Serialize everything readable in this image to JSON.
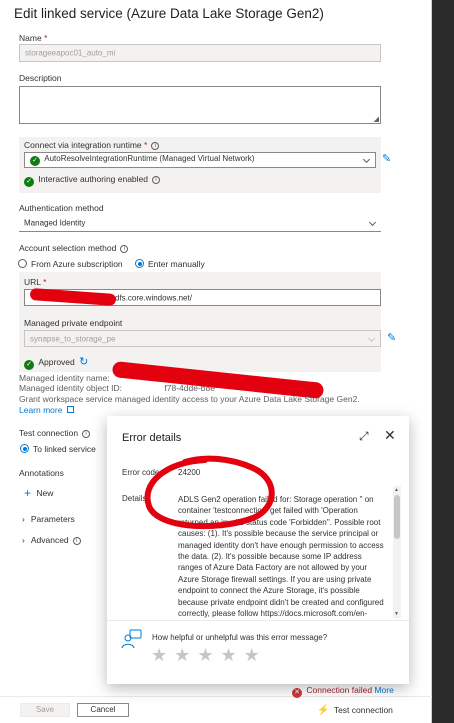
{
  "panel": {
    "title": "Edit linked service (Azure Data Lake Storage Gen2)"
  },
  "name": {
    "label": "Name",
    "required_mark": "*",
    "value": "storageeapoc01_auto_mi"
  },
  "description": {
    "label": "Description",
    "value": ""
  },
  "runtime": {
    "label": "Connect via integration runtime",
    "required_mark": "*",
    "value": "AutoResolveIntegrationRuntime (Managed Virtual Network)",
    "interactive_status": "Interactive authoring enabled"
  },
  "auth": {
    "label": "Authentication method",
    "value": "Managed Identity"
  },
  "account_selection": {
    "label": "Account selection method",
    "options": [
      "From Azure subscription",
      "Enter manually"
    ],
    "selected": "Enter manually"
  },
  "url": {
    "label": "URL",
    "required_mark": "*",
    "value_visible": "dfs.core.windows.net/"
  },
  "private_endpoint": {
    "label": "Managed private endpoint",
    "value": "synapse_to_storage_pe",
    "status": "Approved"
  },
  "identity": {
    "name_label": "Managed identity name:",
    "object_label": "Managed identity object ID:",
    "object_partial": "f78-4dde-b8e",
    "grant_text": "Grant workspace service managed identity access to your Azure Data Lake Storage Gen2.",
    "learn_more": "Learn more"
  },
  "test_connection": {
    "label": "Test connection",
    "option": "To linked service"
  },
  "annotations": {
    "label": "Annotations",
    "new_label": "New"
  },
  "sections": {
    "parameters": "Parameters",
    "advanced": "Advanced"
  },
  "error_dialog": {
    "title": "Error details",
    "code_label": "Error code",
    "code_value": "24200",
    "details_label": "Details",
    "message": "ADLS Gen2 operation failed for: Storage operation '' on container 'testconnection' get failed with 'Operation returned an invalid status code 'Forbidden''. Possible root causes: (1). It's possible because the service principal or managed identity don't have enough permission to access the data. (2). It's possible because some IP address ranges of Azure Data Factory are not allowed by your Azure Storage firewall settings. If you are using private endpoint to connect the Azure Storage, it's possible because private endpoint didn't be created and configured correctly, please follow https://docs.microsoft.com/en-us/azure/data-factory/tutorial-copy-data-portal-private to create it",
    "feedback_question": "How helpful or unhelpful was this error message?",
    "star_glyph": "★",
    "star_count": 5
  },
  "footer": {
    "save_label": "Save",
    "cancel_label": "Cancel",
    "status_text": "Connection failed",
    "more_link": "More",
    "test_connection_label": "Test connection"
  },
  "colors": {
    "accent": "#0078d4",
    "success": "#107c10",
    "error": "#d13438",
    "redaction": "#e3000f"
  }
}
